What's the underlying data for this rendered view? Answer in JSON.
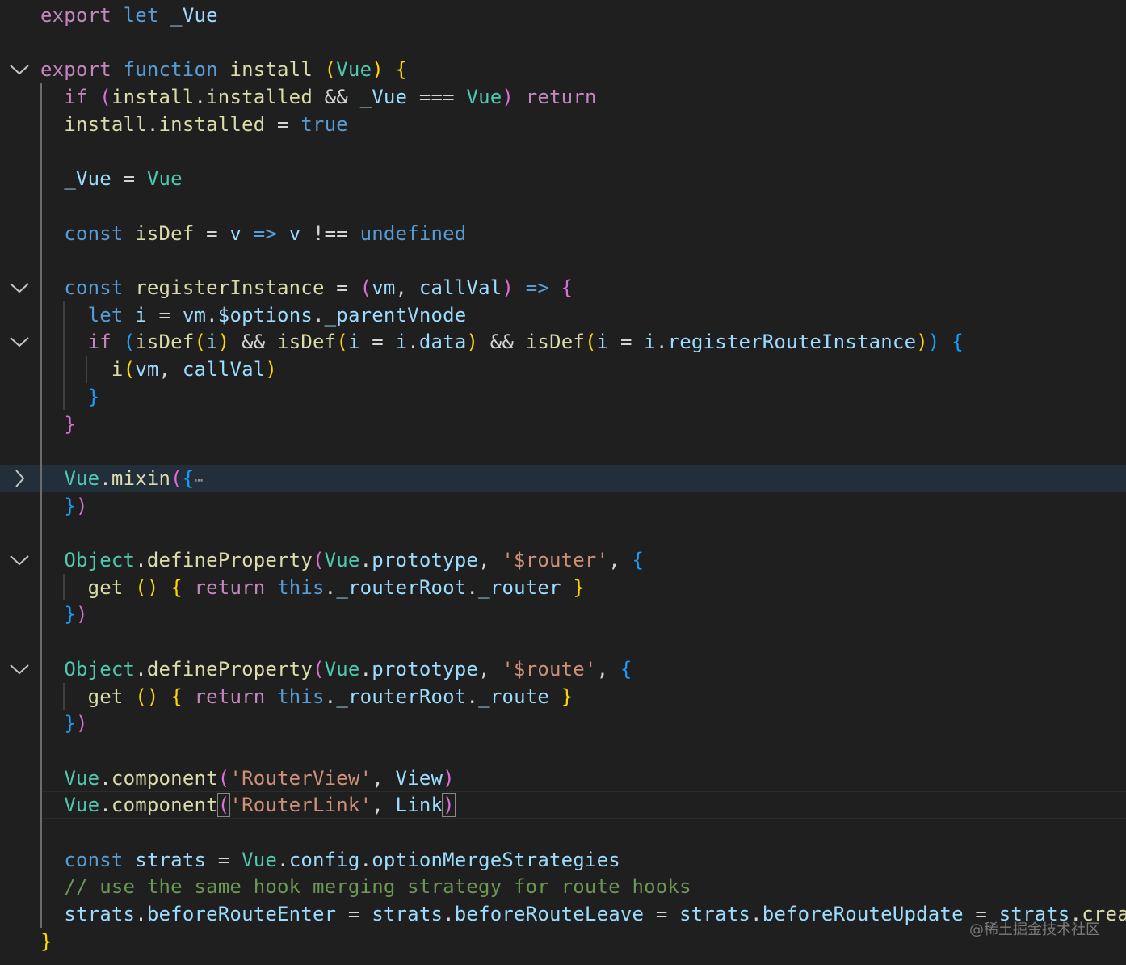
{
  "editor": {
    "language": "javascript",
    "theme": "dark",
    "lines": [
      {
        "n": 1,
        "fold": null,
        "tokens": [
          [
            "kw-purple",
            "export"
          ],
          [
            "op",
            " "
          ],
          [
            "kw-blue",
            "let"
          ],
          [
            "op",
            " "
          ],
          [
            "var",
            "_Vue"
          ]
        ]
      },
      {
        "n": 2,
        "fold": null,
        "tokens": []
      },
      {
        "n": 3,
        "fold": "expanded",
        "tokens": [
          [
            "kw-purple",
            "export"
          ],
          [
            "op",
            " "
          ],
          [
            "kw-blue",
            "function"
          ],
          [
            "op",
            " "
          ],
          [
            "fn",
            "install"
          ],
          [
            "op",
            " "
          ],
          [
            "b1",
            "("
          ],
          [
            "type",
            "Vue"
          ],
          [
            "b1",
            ")"
          ],
          [
            "op",
            " "
          ],
          [
            "b1",
            "{"
          ]
        ]
      },
      {
        "n": 4,
        "fold": null,
        "tokens": [
          [
            "op",
            "  "
          ],
          [
            "kw-purple",
            "if"
          ],
          [
            "op",
            " "
          ],
          [
            "b2",
            "("
          ],
          [
            "fn",
            "install"
          ],
          [
            "op",
            "."
          ],
          [
            "fn",
            "installed"
          ],
          [
            "op",
            " && "
          ],
          [
            "var",
            "_Vue"
          ],
          [
            "op",
            " === "
          ],
          [
            "type",
            "Vue"
          ],
          [
            "b2",
            ")"
          ],
          [
            "op",
            " "
          ],
          [
            "kw-purple",
            "return"
          ]
        ]
      },
      {
        "n": 5,
        "fold": null,
        "tokens": [
          [
            "op",
            "  "
          ],
          [
            "fn",
            "install"
          ],
          [
            "op",
            "."
          ],
          [
            "fn",
            "installed"
          ],
          [
            "op",
            " = "
          ],
          [
            "kw-blue",
            "true"
          ]
        ]
      },
      {
        "n": 6,
        "fold": null,
        "tokens": []
      },
      {
        "n": 7,
        "fold": null,
        "tokens": [
          [
            "op",
            "  "
          ],
          [
            "var",
            "_Vue"
          ],
          [
            "op",
            " = "
          ],
          [
            "type",
            "Vue"
          ]
        ]
      },
      {
        "n": 8,
        "fold": null,
        "tokens": []
      },
      {
        "n": 9,
        "fold": null,
        "tokens": [
          [
            "op",
            "  "
          ],
          [
            "kw-blue",
            "const"
          ],
          [
            "op",
            " "
          ],
          [
            "fn",
            "isDef"
          ],
          [
            "op",
            " = "
          ],
          [
            "var",
            "v"
          ],
          [
            "op",
            " "
          ],
          [
            "kw-blue",
            "=>"
          ],
          [
            "op",
            " "
          ],
          [
            "var",
            "v"
          ],
          [
            "op",
            " !== "
          ],
          [
            "kw-blue",
            "undefined"
          ]
        ]
      },
      {
        "n": 10,
        "fold": null,
        "tokens": []
      },
      {
        "n": 11,
        "fold": "expanded",
        "tokens": [
          [
            "op",
            "  "
          ],
          [
            "kw-blue",
            "const"
          ],
          [
            "op",
            " "
          ],
          [
            "fn",
            "registerInstance"
          ],
          [
            "op",
            " = "
          ],
          [
            "b2",
            "("
          ],
          [
            "var",
            "vm"
          ],
          [
            "op",
            ", "
          ],
          [
            "var",
            "callVal"
          ],
          [
            "b2",
            ")"
          ],
          [
            "op",
            " "
          ],
          [
            "kw-blue",
            "=>"
          ],
          [
            "op",
            " "
          ],
          [
            "b2",
            "{"
          ]
        ]
      },
      {
        "n": 12,
        "fold": null,
        "tokens": [
          [
            "op",
            "    "
          ],
          [
            "kw-blue",
            "let"
          ],
          [
            "op",
            " "
          ],
          [
            "var",
            "i"
          ],
          [
            "op",
            " = "
          ],
          [
            "var",
            "vm"
          ],
          [
            "op",
            "."
          ],
          [
            "var",
            "$options"
          ],
          [
            "op",
            "."
          ],
          [
            "var",
            "_parentVnode"
          ]
        ]
      },
      {
        "n": 13,
        "fold": "expanded",
        "tokens": [
          [
            "op",
            "    "
          ],
          [
            "kw-purple",
            "if"
          ],
          [
            "op",
            " "
          ],
          [
            "b3",
            "("
          ],
          [
            "fn",
            "isDef"
          ],
          [
            "b1",
            "("
          ],
          [
            "var",
            "i"
          ],
          [
            "b1",
            ")"
          ],
          [
            "op",
            " && "
          ],
          [
            "fn",
            "isDef"
          ],
          [
            "b1",
            "("
          ],
          [
            "var",
            "i"
          ],
          [
            "op",
            " = "
          ],
          [
            "var",
            "i"
          ],
          [
            "op",
            "."
          ],
          [
            "var",
            "data"
          ],
          [
            "b1",
            ")"
          ],
          [
            "op",
            " && "
          ],
          [
            "fn",
            "isDef"
          ],
          [
            "b1",
            "("
          ],
          [
            "var",
            "i"
          ],
          [
            "op",
            " = "
          ],
          [
            "var",
            "i"
          ],
          [
            "op",
            "."
          ],
          [
            "var",
            "registerRouteInstance"
          ],
          [
            "b1",
            ")"
          ],
          [
            "b3",
            ")"
          ],
          [
            "op",
            " "
          ],
          [
            "b3",
            "{"
          ]
        ]
      },
      {
        "n": 14,
        "fold": null,
        "tokens": [
          [
            "op",
            "      "
          ],
          [
            "fn",
            "i"
          ],
          [
            "b1",
            "("
          ],
          [
            "var",
            "vm"
          ],
          [
            "op",
            ", "
          ],
          [
            "var",
            "callVal"
          ],
          [
            "b1",
            ")"
          ]
        ]
      },
      {
        "n": 15,
        "fold": null,
        "tokens": [
          [
            "op",
            "    "
          ],
          [
            "b3",
            "}"
          ]
        ]
      },
      {
        "n": 16,
        "fold": null,
        "tokens": [
          [
            "op",
            "  "
          ],
          [
            "b2",
            "}"
          ]
        ]
      },
      {
        "n": 17,
        "fold": null,
        "tokens": []
      },
      {
        "n": 18,
        "fold": "collapsed",
        "highlight": true,
        "tokens": [
          [
            "op",
            "  "
          ],
          [
            "type",
            "Vue"
          ],
          [
            "op",
            "."
          ],
          [
            "fn",
            "mixin"
          ],
          [
            "b2",
            "("
          ],
          [
            "b3",
            "{"
          ],
          [
            "ellipsis",
            "⋯"
          ]
        ]
      },
      {
        "n": 19,
        "fold": null,
        "tokens": [
          [
            "op",
            "  "
          ],
          [
            "b3",
            "}"
          ],
          [
            "b2",
            ")"
          ]
        ]
      },
      {
        "n": 20,
        "fold": null,
        "tokens": []
      },
      {
        "n": 21,
        "fold": "expanded",
        "tokens": [
          [
            "op",
            "  "
          ],
          [
            "type",
            "Object"
          ],
          [
            "op",
            "."
          ],
          [
            "fn",
            "defineProperty"
          ],
          [
            "b2",
            "("
          ],
          [
            "type",
            "Vue"
          ],
          [
            "op",
            "."
          ],
          [
            "var",
            "prototype"
          ],
          [
            "op",
            ", "
          ],
          [
            "str",
            "'$router'"
          ],
          [
            "op",
            ", "
          ],
          [
            "b3",
            "{"
          ]
        ]
      },
      {
        "n": 22,
        "fold": null,
        "tokens": [
          [
            "op",
            "    "
          ],
          [
            "fn",
            "get"
          ],
          [
            "op",
            " "
          ],
          [
            "b1",
            "()"
          ],
          [
            "op",
            " "
          ],
          [
            "b1",
            "{"
          ],
          [
            "op",
            " "
          ],
          [
            "kw-purple",
            "return"
          ],
          [
            "op",
            " "
          ],
          [
            "kw-blue",
            "this"
          ],
          [
            "op",
            "."
          ],
          [
            "var",
            "_routerRoot"
          ],
          [
            "op",
            "."
          ],
          [
            "var",
            "_router"
          ],
          [
            "op",
            " "
          ],
          [
            "b1",
            "}"
          ]
        ]
      },
      {
        "n": 23,
        "fold": null,
        "tokens": [
          [
            "op",
            "  "
          ],
          [
            "b3",
            "}"
          ],
          [
            "b2",
            ")"
          ]
        ]
      },
      {
        "n": 24,
        "fold": null,
        "tokens": []
      },
      {
        "n": 25,
        "fold": "expanded",
        "tokens": [
          [
            "op",
            "  "
          ],
          [
            "type",
            "Object"
          ],
          [
            "op",
            "."
          ],
          [
            "fn",
            "defineProperty"
          ],
          [
            "b2",
            "("
          ],
          [
            "type",
            "Vue"
          ],
          [
            "op",
            "."
          ],
          [
            "var",
            "prototype"
          ],
          [
            "op",
            ", "
          ],
          [
            "str",
            "'$route'"
          ],
          [
            "op",
            ", "
          ],
          [
            "b3",
            "{"
          ]
        ]
      },
      {
        "n": 26,
        "fold": null,
        "tokens": [
          [
            "op",
            "    "
          ],
          [
            "fn",
            "get"
          ],
          [
            "op",
            " "
          ],
          [
            "b1",
            "()"
          ],
          [
            "op",
            " "
          ],
          [
            "b1",
            "{"
          ],
          [
            "op",
            " "
          ],
          [
            "kw-purple",
            "return"
          ],
          [
            "op",
            " "
          ],
          [
            "kw-blue",
            "this"
          ],
          [
            "op",
            "."
          ],
          [
            "var",
            "_routerRoot"
          ],
          [
            "op",
            "."
          ],
          [
            "var",
            "_route"
          ],
          [
            "op",
            " "
          ],
          [
            "b1",
            "}"
          ]
        ]
      },
      {
        "n": 27,
        "fold": null,
        "tokens": [
          [
            "op",
            "  "
          ],
          [
            "b3",
            "}"
          ],
          [
            "b2",
            ")"
          ]
        ]
      },
      {
        "n": 28,
        "fold": null,
        "tokens": []
      },
      {
        "n": 29,
        "fold": null,
        "tokens": [
          [
            "op",
            "  "
          ],
          [
            "type",
            "Vue"
          ],
          [
            "op",
            "."
          ],
          [
            "fn",
            "component"
          ],
          [
            "b2",
            "("
          ],
          [
            "str",
            "'RouterView'"
          ],
          [
            "op",
            ", "
          ],
          [
            "var",
            "View"
          ],
          [
            "b2",
            ")"
          ]
        ]
      },
      {
        "n": 30,
        "fold": null,
        "cursor": true,
        "tokens": [
          [
            "op",
            "  "
          ],
          [
            "type",
            "Vue"
          ],
          [
            "op",
            "."
          ],
          [
            "fn",
            "component"
          ],
          [
            "b2 bracket-match",
            "("
          ],
          [
            "str",
            "'RouterLink'"
          ],
          [
            "op",
            ", "
          ],
          [
            "var",
            "Link"
          ],
          [
            "b2 bracket-match",
            ")"
          ]
        ]
      },
      {
        "n": 31,
        "fold": null,
        "tokens": []
      },
      {
        "n": 32,
        "fold": null,
        "tokens": [
          [
            "op",
            "  "
          ],
          [
            "kw-blue",
            "const"
          ],
          [
            "op",
            " "
          ],
          [
            "var",
            "strats"
          ],
          [
            "op",
            " = "
          ],
          [
            "type",
            "Vue"
          ],
          [
            "op",
            "."
          ],
          [
            "var",
            "config"
          ],
          [
            "op",
            "."
          ],
          [
            "var",
            "optionMergeStrategies"
          ]
        ]
      },
      {
        "n": 33,
        "fold": null,
        "tokens": [
          [
            "op",
            "  "
          ],
          [
            "cmt",
            "// use the same hook merging strategy for route hooks"
          ]
        ]
      },
      {
        "n": 34,
        "fold": null,
        "tokens": [
          [
            "op",
            "  "
          ],
          [
            "var",
            "strats"
          ],
          [
            "op",
            "."
          ],
          [
            "var",
            "beforeRouteEnter"
          ],
          [
            "op",
            " = "
          ],
          [
            "var",
            "strats"
          ],
          [
            "op",
            "."
          ],
          [
            "var",
            "beforeRouteLeave"
          ],
          [
            "op",
            " = "
          ],
          [
            "var",
            "strats"
          ],
          [
            "op",
            "."
          ],
          [
            "var",
            "beforeRouteUpdate"
          ],
          [
            "op",
            " = "
          ],
          [
            "var",
            "strats"
          ],
          [
            "op",
            "."
          ],
          [
            "fn",
            "created"
          ]
        ]
      },
      {
        "n": 35,
        "fold": null,
        "tokens": [
          [
            "b1",
            "}"
          ]
        ]
      }
    ]
  },
  "watermark": "@稀土掘金技术社区"
}
